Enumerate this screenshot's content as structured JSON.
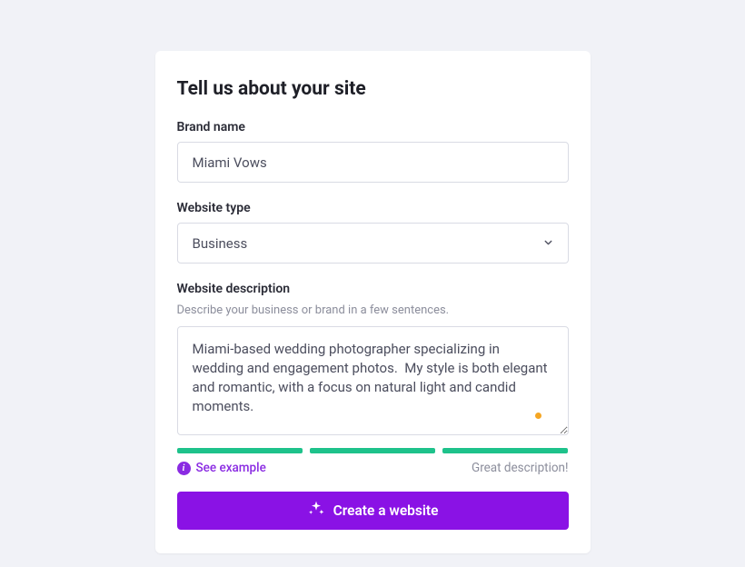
{
  "title": "Tell us about your site",
  "brand": {
    "label": "Brand name",
    "value": "Miami Vows"
  },
  "websiteType": {
    "label": "Website type",
    "value": "Business"
  },
  "description": {
    "label": "Website description",
    "helper": "Describe your business or brand in a few sentences.",
    "value": "Miami-based wedding photographer specializing in wedding and engagement photos.  My style is both elegant and romantic, with a focus on natural light and candid moments.",
    "scoreText": "Great description!",
    "seeExample": "See example"
  },
  "cta": "Create a website",
  "colors": {
    "accent": "#8a12e5",
    "progress": "#1ec28b",
    "statusDot": "#f5a623"
  }
}
